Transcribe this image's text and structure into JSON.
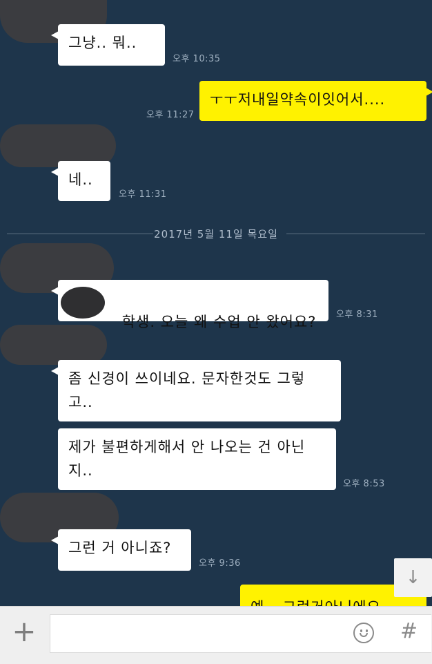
{
  "messages": [
    {
      "text": "그냥.. 뭐..",
      "time": "오후 10:35",
      "from": "other"
    },
    {
      "text": "ㅜㅜ저내일약속이잇어서....",
      "time": "오후 11:27",
      "from": "me"
    },
    {
      "text": "네..",
      "time": "오후 11:31",
      "from": "other"
    },
    {
      "text": "학생. 오늘 왜 수업 안 왔어요?",
      "time": "오후 8:31",
      "from": "other"
    },
    {
      "text": "좀 신경이 쓰이네요. 문자한것도 그렇\n고..",
      "time": "",
      "from": "other"
    },
    {
      "text": "제가 불편하게해서 안 나오는 건 아닌\n지..",
      "time": "오후 8:53",
      "from": "other"
    },
    {
      "text": "그런 거 아니죠?",
      "time": "오후 9:36",
      "from": "other"
    },
    {
      "text": "예~ 그런거아니에요",
      "time": "",
      "from": "me"
    }
  ],
  "date_divider": "2017년 5월 11일 목요일",
  "composer": {
    "placeholder": "",
    "emoji_icon": "smiley-icon",
    "hash_label": "#",
    "plus_label": "+"
  },
  "scroll_button": {
    "icon": "arrow-down-icon",
    "label": "↓"
  },
  "colors": {
    "background": "#1e354b",
    "incoming": "#ffffff",
    "outgoing": "#fff200"
  }
}
